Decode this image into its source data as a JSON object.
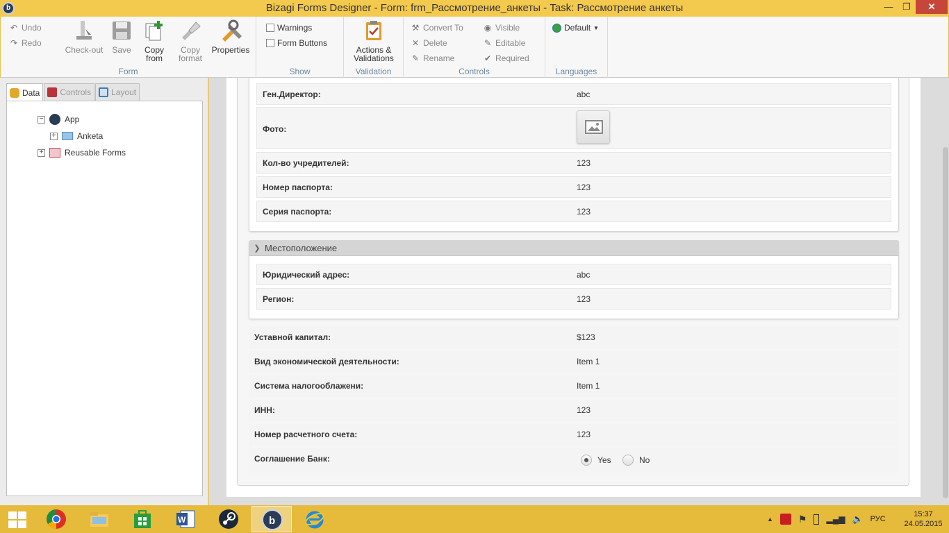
{
  "window": {
    "title": "Bizagi Forms Designer  - Form: frm_Рассмотрение_анкеты - Task:  Рассмотрение анкеты",
    "min_glyph": "—",
    "max_glyph": "❐",
    "close_glyph": "✕",
    "app_icon_letter": "b"
  },
  "ribbon": {
    "undo": "Undo",
    "redo": "Redo",
    "checkout": "Check-out",
    "save": "Save",
    "copy_from_1": "Copy",
    "copy_from_2": "from",
    "copy_format_1": "Copy",
    "copy_format_2": "format",
    "properties": "Properties",
    "group_form": "Form",
    "warnings": "Warnings",
    "form_buttons": "Form Buttons",
    "group_show": "Show",
    "actions_1": "Actions &",
    "actions_2": "Validations",
    "group_validation": "Validation",
    "convert_to": "Convert To",
    "delete": "Delete",
    "rename": "Rename",
    "visible": "Visible",
    "editable": "Editable",
    "required": "Required",
    "group_controls": "Controls",
    "language": "Default",
    "group_languages": "Languages"
  },
  "left_panel": {
    "tabs": [
      "Data",
      "Controls",
      "Layout"
    ],
    "tree": {
      "app": "App",
      "anketa": "Anketa",
      "reusable_forms": "Reusable Forms"
    }
  },
  "form": {
    "group1_rows": [
      {
        "label": "Ген.Директор:",
        "value": "abc"
      },
      {
        "label": "Фото:",
        "value": ""
      },
      {
        "label": "Кол-во учредителей:",
        "value": "123"
      },
      {
        "label": "Номер паспорта:",
        "value": "123"
      },
      {
        "label": "Серия паспорта:",
        "value": "123"
      }
    ],
    "group2": {
      "title": "Местоположение",
      "rows": [
        {
          "label": "Юридический адрес:",
          "value": "abc"
        },
        {
          "label": "Регион:",
          "value": "123"
        }
      ]
    },
    "rows": [
      {
        "label": "Уставной капитал:",
        "value": "$123"
      },
      {
        "label": "Вид экономической деятельности:",
        "value": "Item 1"
      },
      {
        "label": "Система налогооблажени:",
        "value": "Item 1"
      },
      {
        "label": "ИНН:",
        "value": "123"
      },
      {
        "label": "Номер расчетного счета:",
        "value": "123"
      }
    ],
    "agreement": {
      "label": "Соглашение Банк:",
      "yes": "Yes",
      "no": "No",
      "selected": "Yes"
    }
  },
  "taskbar": {
    "apps": [
      "start",
      "chrome",
      "file-explorer",
      "windows-store",
      "word",
      "steam",
      "bizagi",
      "internet-explorer"
    ],
    "language": "РУС",
    "time": "15:37",
    "date": "24.05.2015"
  },
  "colors": {
    "titlebar": "#f3c94e",
    "taskbar": "#e6ba3a",
    "accent_group_label": "#6a8aa5",
    "close_button": "#c7463a"
  }
}
